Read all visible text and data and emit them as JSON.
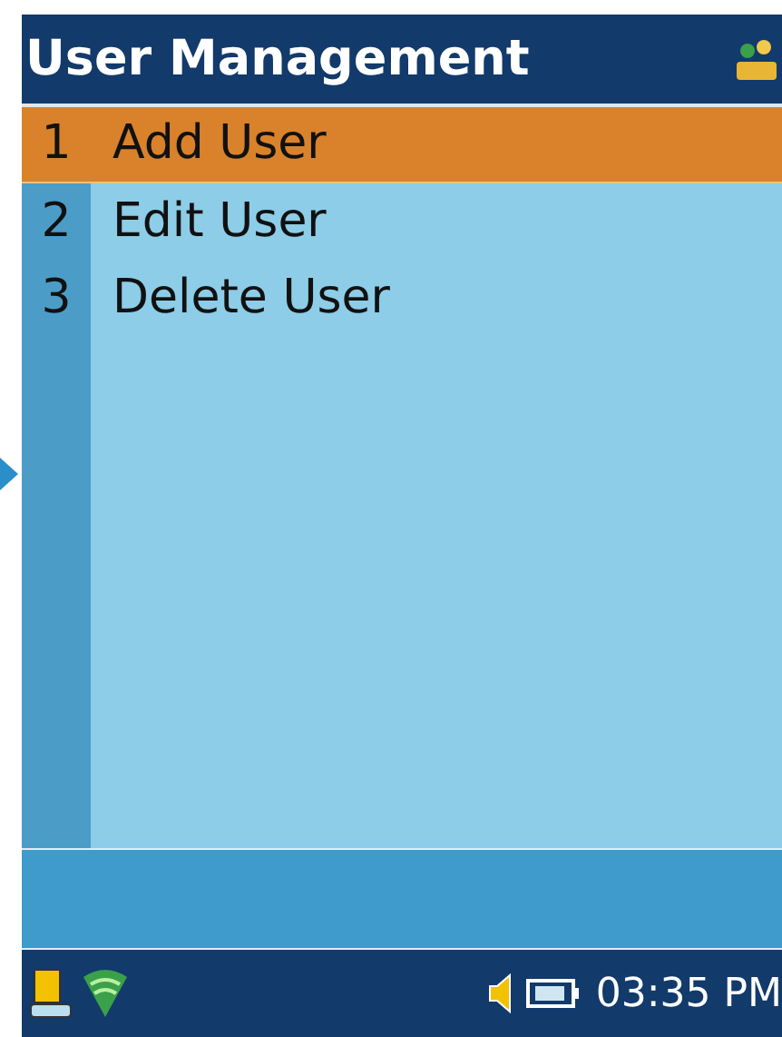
{
  "title_bar": {
    "title": "User Management"
  },
  "menu": {
    "items": [
      {
        "number": "1",
        "label": "Add User",
        "selected": true
      },
      {
        "number": "2",
        "label": "Edit User",
        "selected": false
      },
      {
        "number": "3",
        "label": "Delete User",
        "selected": false
      }
    ]
  },
  "status_bar": {
    "time": "03:35 PM"
  }
}
